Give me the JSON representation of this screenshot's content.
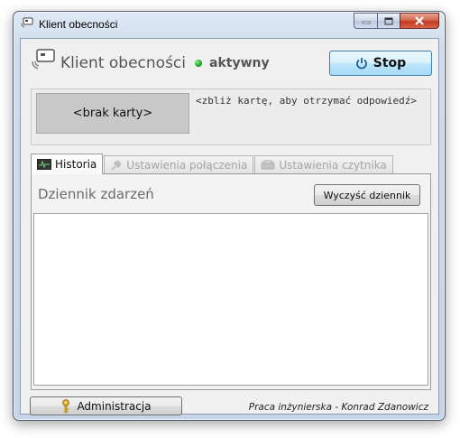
{
  "window": {
    "title": "Klient obecności"
  },
  "header": {
    "app_title": "Klient obecności",
    "status_text": "aktywny",
    "status_color": "#1aa31a",
    "stop_label": "Stop",
    "stop_icon": "power-icon"
  },
  "card": {
    "value": "<brak karty>",
    "hint": "<zbliż kartę, aby otrzymać odpowiedź>"
  },
  "tabs": [
    {
      "label": "Historia",
      "icon": "log-monitor-icon",
      "active": true
    },
    {
      "label": "Ustawienia połączenia",
      "icon": "plug-icon",
      "active": false
    },
    {
      "label": "Ustawienia czytnika",
      "icon": "card-reader-icon",
      "active": false
    }
  ],
  "history": {
    "title": "Dziennik zdarzeń",
    "clear_label": "Wyczyść dziennik",
    "entries": []
  },
  "footer": {
    "admin_label": "Administracja",
    "admin_icon": "key-icon",
    "credits": "Praca inżynierska - Konrad Zdanowicz"
  }
}
